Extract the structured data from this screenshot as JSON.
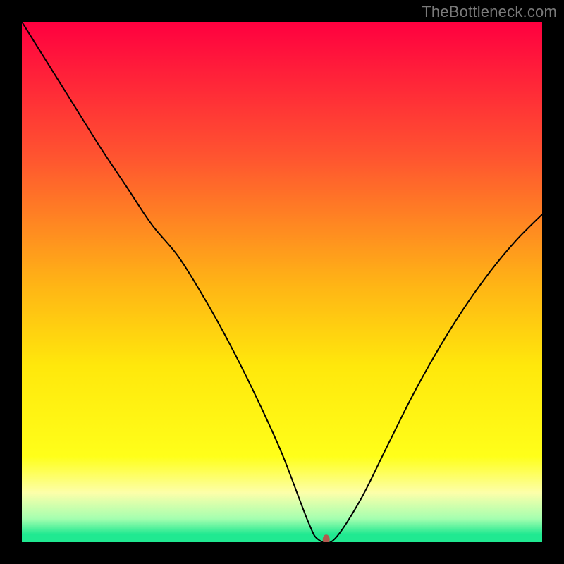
{
  "attribution": "TheBottleneck.com",
  "chart_data": {
    "type": "line",
    "title": "",
    "xlabel": "",
    "ylabel": "",
    "xlim": [
      0,
      100
    ],
    "ylim": [
      0,
      100
    ],
    "grid": false,
    "legend": false,
    "background": {
      "type": "vertical-gradient",
      "stops": [
        {
          "pos": 0.0,
          "color": "#ff0040"
        },
        {
          "pos": 0.26,
          "color": "#ff5530"
        },
        {
          "pos": 0.5,
          "color": "#ffb316"
        },
        {
          "pos": 0.66,
          "color": "#ffe80c"
        },
        {
          "pos": 0.835,
          "color": "#ffff1a"
        },
        {
          "pos": 0.905,
          "color": "#fdffaa"
        },
        {
          "pos": 0.955,
          "color": "#a5ffb0"
        },
        {
          "pos": 0.985,
          "color": "#20e991"
        },
        {
          "pos": 1.0,
          "color": "#20e991"
        }
      ]
    },
    "series": [
      {
        "name": "bottleneck-curve",
        "color": "#000000",
        "width": 2,
        "x": [
          0,
          5,
          10,
          15,
          20,
          25,
          30,
          35,
          40,
          45,
          50,
          55,
          57,
          60,
          65,
          70,
          75,
          80,
          85,
          90,
          95,
          100
        ],
        "y": [
          100,
          92,
          84,
          76,
          68.5,
          61,
          55,
          47,
          38,
          28,
          17,
          4,
          0.5,
          0.5,
          8,
          18,
          28,
          37,
          45,
          52,
          58,
          63
        ]
      }
    ],
    "marker": {
      "name": "optimal-point",
      "x": 58.5,
      "y": 0.5,
      "rx": 5,
      "ry": 7,
      "fill": "#b1594e"
    }
  }
}
